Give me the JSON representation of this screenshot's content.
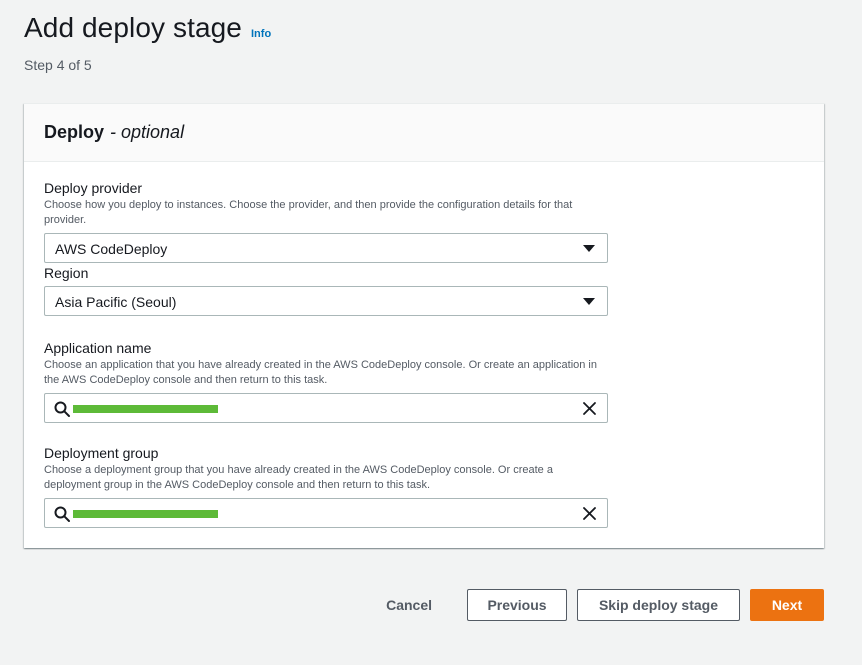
{
  "header": {
    "title": "Add deploy stage",
    "info_label": "Info",
    "step": "Step 4 of 5"
  },
  "panel": {
    "title": "Deploy",
    "optional": "- optional"
  },
  "fields": {
    "provider": {
      "label": "Deploy provider",
      "description": "Choose how you deploy to instances. Choose the provider, and then provide the configuration details for that provider.",
      "value": "AWS CodeDeploy"
    },
    "region": {
      "label": "Region",
      "value": "Asia Pacific (Seoul)"
    },
    "application": {
      "label": "Application name",
      "description": "Choose an application that you have already created in the AWS CodeDeploy console. Or create an application in the AWS CodeDeploy console and then return to this task.",
      "value_redacted": true
    },
    "deployment_group": {
      "label": "Deployment group",
      "description": "Choose a deployment group that you have already created in the AWS CodeDeploy console. Or create a deployment group in the AWS CodeDeploy console and then return to this task.",
      "value_redacted": true
    }
  },
  "actions": {
    "cancel": "Cancel",
    "previous": "Previous",
    "skip": "Skip deploy stage",
    "next": "Next"
  },
  "colors": {
    "accent": "#ec7211",
    "link": "#0073bb",
    "redaction": "#5dba38"
  },
  "icons": [
    "search-icon",
    "clear-icon",
    "caret-down-icon"
  ]
}
